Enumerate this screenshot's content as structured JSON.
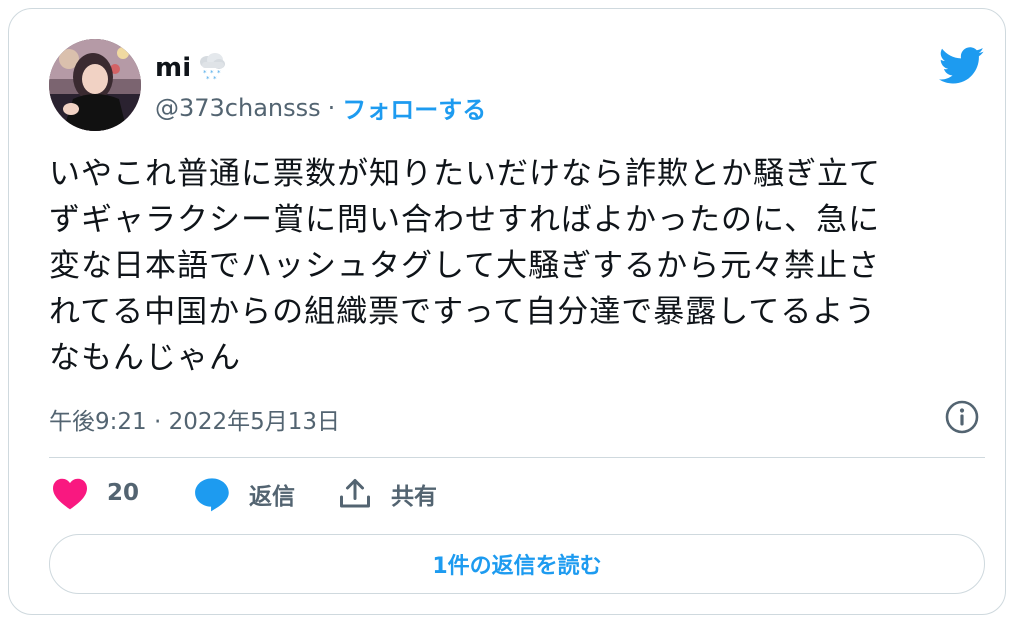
{
  "user": {
    "name": "mi",
    "name_emoji_icon": "snow-cloud-icon",
    "handle": "@373chansss",
    "separator": "·",
    "follow_label": "フォローする"
  },
  "tweet": {
    "text": "いやこれ普通に票数が知りたいだけなら詐欺とか騒ぎ立て\nずギャラクシー賞に問い合わせすればよかったのに、急に\n変な日本語でハッシュタグして大騒ぎするから元々禁止さ\nれてる中国からの組織票ですって自分達で暴露してるよう\nなもんじゃん",
    "timestamp": "午後9:21 · 2022年5月13日"
  },
  "actions": {
    "like_count": "20",
    "reply_label": "返信",
    "share_label": "共有"
  },
  "read_replies_label": "1件の返信を読む",
  "colors": {
    "accent": "#1d9bf0",
    "like": "#f91880",
    "muted": "#536471",
    "border": "#cfd9de"
  }
}
